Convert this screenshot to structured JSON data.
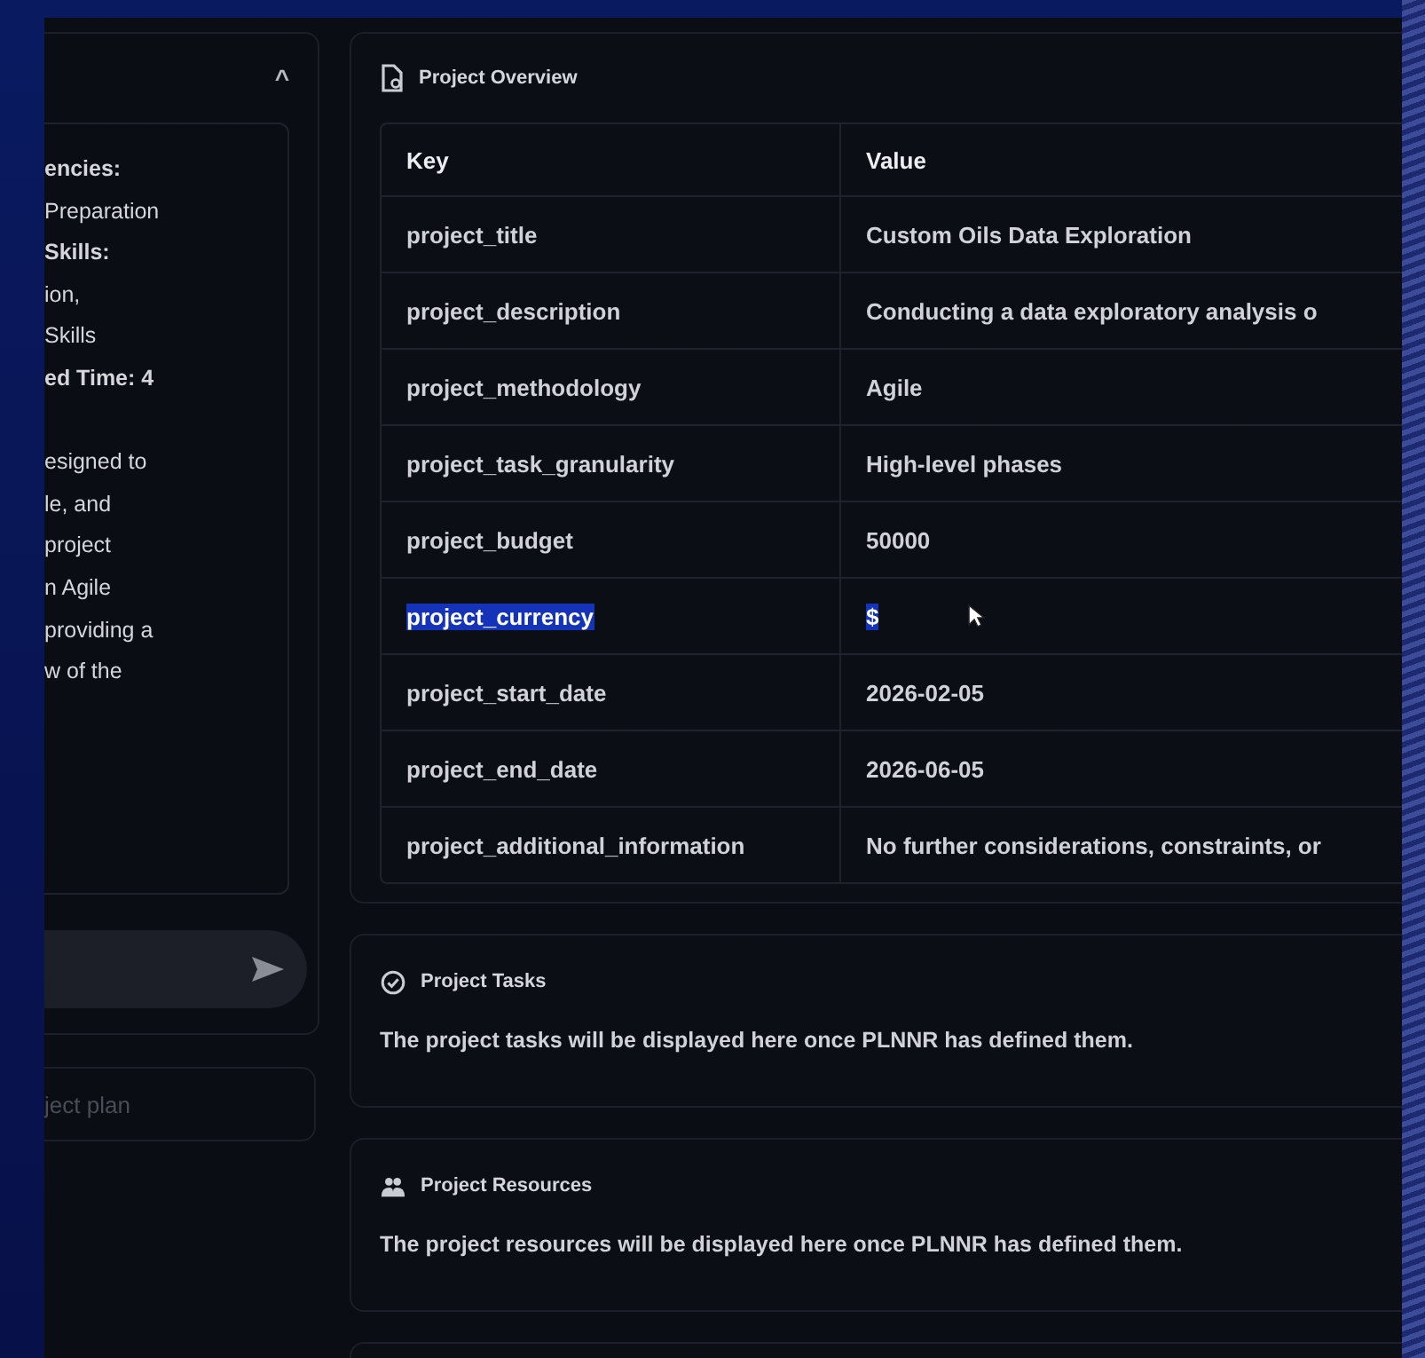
{
  "sidebar": {
    "collapse_icon": "^",
    "paragraphs": [
      [
        {
          "text": "encies:",
          "bold": true
        },
        {
          "text": "Preparation",
          "bold": false
        },
        {
          "text": "Skills:",
          "bold": true
        },
        {
          "text": "ion,",
          "bold": false
        },
        {
          "text": "Skills",
          "bold": false
        },
        {
          "text": "ed Time: 4",
          "bold": true
        }
      ],
      [
        {
          "text": "esigned to",
          "bold": false
        },
        {
          "text": "le, and",
          "bold": false
        },
        {
          "text": "project",
          "bold": false
        },
        {
          "text": "n Agile",
          "bold": false
        },
        {
          "text": "providing a",
          "bold": false
        },
        {
          "text": "w of the",
          "bold": false
        }
      ]
    ],
    "plan_field": {
      "placeholder": "ject plan"
    }
  },
  "overview": {
    "title": "Project Overview",
    "columns": [
      "Key",
      "Value"
    ],
    "rows": [
      {
        "key": "project_title",
        "value": "Custom Oils Data Exploration",
        "selected": false
      },
      {
        "key": "project_description",
        "value": "Conducting a data exploratory analysis o",
        "selected": false
      },
      {
        "key": "project_methodology",
        "value": "Agile",
        "selected": false
      },
      {
        "key": "project_task_granularity",
        "value": "High-level phases",
        "selected": false
      },
      {
        "key": "project_budget",
        "value": "50000",
        "selected": false
      },
      {
        "key": "project_currency",
        "value": "$",
        "selected": true
      },
      {
        "key": "project_start_date",
        "value": "2026-02-05",
        "selected": false
      },
      {
        "key": "project_end_date",
        "value": "2026-06-05",
        "selected": false
      },
      {
        "key": "project_additional_information",
        "value": "No further considerations, constraints, or",
        "selected": false
      }
    ]
  },
  "sections": [
    {
      "kind": "tasks",
      "title": "Project Tasks",
      "text": "The project tasks will be displayed here once PLNNR has defined them."
    },
    {
      "kind": "resources",
      "title": "Project Resources",
      "text": "The project resources will be displayed here once PLNNR has defined them."
    }
  ]
}
